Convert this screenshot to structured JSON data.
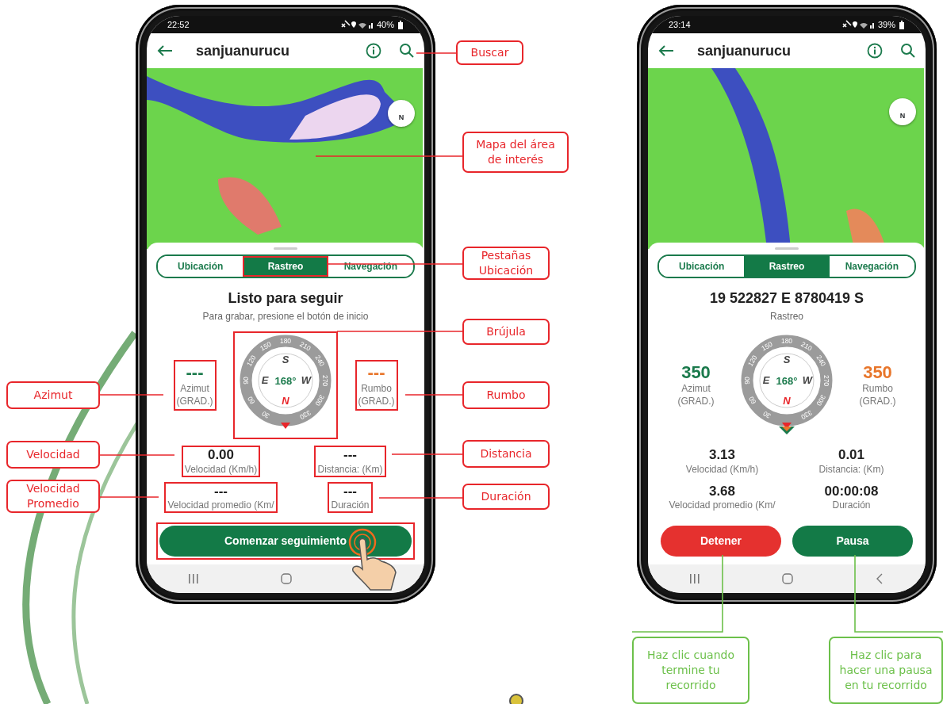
{
  "phones": [
    {
      "status": {
        "time": "22:52",
        "battery": "40%"
      },
      "app_bar": {
        "title": "sanjuanurucu"
      },
      "map": {
        "compass_label": "N"
      },
      "tabs": [
        {
          "label": "Ubicación",
          "selected": false,
          "highlighted": false
        },
        {
          "label": "Rastreo",
          "selected": true,
          "highlighted": true
        },
        {
          "label": "Navegación",
          "selected": false,
          "highlighted": false
        }
      ],
      "heading": {
        "title": "Listo para seguir",
        "subtitle": "Para grabar, presione el botón de inicio"
      },
      "compass": {
        "reading": "168°",
        "cardinals": [
          "S",
          "W",
          "N",
          "E"
        ],
        "dial_labels": [
          "150",
          "180",
          "210",
          "240",
          "270",
          "300",
          "330",
          "30",
          "60",
          "90",
          "120"
        ],
        "highlighted": true,
        "target_marker": false
      },
      "azimut": {
        "value": "---",
        "label": "Azimut",
        "unit": "(GRAD.)",
        "highlighted": true
      },
      "rumbo": {
        "value": "---",
        "label": "Rumbo",
        "unit": "(GRAD.)",
        "highlighted": true
      },
      "stats": [
        {
          "value": "0.00",
          "label": "Velocidad (Km/h)",
          "highlighted": true
        },
        {
          "value": "---",
          "label": "Distancia: (Km)",
          "highlighted": true
        },
        {
          "value": "---",
          "label": "Velocidad promedio (Km/",
          "highlighted": true
        },
        {
          "value": "---",
          "label": "Duración",
          "highlighted": true
        }
      ],
      "buttons": [
        {
          "label": "Comenzar seguimiento",
          "kind": "start"
        }
      ],
      "buttons_highlighted": true,
      "tap_hint": true
    },
    {
      "status": {
        "time": "23:14",
        "battery": "39%"
      },
      "app_bar": {
        "title": "sanjuanurucu"
      },
      "map": {
        "compass_label": "N"
      },
      "tabs": [
        {
          "label": "Ubicación",
          "selected": false,
          "highlighted": false
        },
        {
          "label": "Rastreo",
          "selected": true,
          "highlighted": false
        },
        {
          "label": "Navegación",
          "selected": false,
          "highlighted": false
        }
      ],
      "heading": {
        "title": "19 522827 E 8780419 S",
        "subtitle": "Rastreo"
      },
      "compass": {
        "reading": "168°",
        "cardinals": [
          "S",
          "W",
          "N",
          "E"
        ],
        "dial_labels": [
          "150",
          "180",
          "210",
          "240",
          "270",
          "300",
          "330",
          "30",
          "60",
          "90",
          "120"
        ],
        "highlighted": false,
        "target_marker": true
      },
      "azimut": {
        "value": "350",
        "label": "Azimut",
        "unit": "(GRAD.)",
        "highlighted": false
      },
      "rumbo": {
        "value": "350",
        "label": "Rumbo",
        "unit": "(GRAD.)",
        "highlighted": false
      },
      "stats": [
        {
          "value": "3.13",
          "label": "Velocidad (Km/h)",
          "highlighted": false
        },
        {
          "value": "0.01",
          "label": "Distancia: (Km)",
          "highlighted": false
        },
        {
          "value": "3.68",
          "label": "Velocidad promedio (Km/",
          "highlighted": false
        },
        {
          "value": "00:00:08",
          "label": "Duración",
          "highlighted": false
        }
      ],
      "buttons": [
        {
          "label": "Detener",
          "kind": "stop"
        },
        {
          "label": "Pausa",
          "kind": "pause"
        }
      ],
      "buttons_highlighted": false,
      "tap_hint": false
    }
  ],
  "callouts": [
    {
      "text": "Buscar",
      "color": "#e8262b"
    },
    {
      "text": "Mapa del área de interés",
      "color": "#e8262b"
    },
    {
      "text": "Pestañas Ubicación",
      "color": "#e8262b"
    },
    {
      "text": "Brújula",
      "color": "#e8262b"
    },
    {
      "text": "Rumbo",
      "color": "#e8262b"
    },
    {
      "text": "Distancia",
      "color": "#e8262b"
    },
    {
      "text": "Duración",
      "color": "#e8262b"
    },
    {
      "text": "Azimut",
      "color": "#e8262b"
    },
    {
      "text": "Velocidad",
      "color": "#e8262b"
    },
    {
      "text": "Velocidad Promedio",
      "color": "#e8262b"
    },
    {
      "text": "Haz clic cuando termine tu recorrido",
      "color": "#6cc04a"
    },
    {
      "text": "Haz clic para hacer una pausa en tu recorrido",
      "color": "#6cc04a"
    }
  ]
}
